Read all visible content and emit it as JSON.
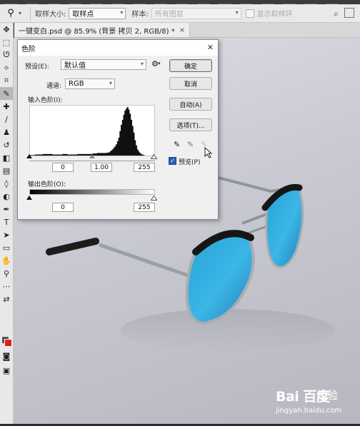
{
  "options_bar": {
    "tool_icon": "eyedropper-icon",
    "sample_size_label": "取样大小:",
    "sample_size_value": "取样点",
    "sample_label": "样本:",
    "sample_value": "所有图层",
    "show_ring_label": "显示取样环"
  },
  "document_tab": {
    "title": "一键变白.psd @ 85.9% (背景 拷贝 2, RGB/8) *",
    "close": "×"
  },
  "levels_dialog": {
    "title": "色阶",
    "close": "✕",
    "preset_label": "预设(E):",
    "preset_value": "默认值",
    "channel_label": "通道:",
    "channel_value": "RGB",
    "input_levels_label": "输入色阶(I):",
    "input_black": "0",
    "input_gamma": "1.00",
    "input_white": "255",
    "output_levels_label": "输出色阶(O):",
    "output_black": "0",
    "output_white": "255",
    "buttons": {
      "ok": "确定",
      "cancel": "取消",
      "auto": "自动(A)",
      "options": "选项(T)..."
    },
    "preview_label": "预览(P)",
    "preview_checked": true
  },
  "histogram": {
    "bins": [
      1,
      1,
      1,
      1,
      2,
      2,
      2,
      2,
      2,
      2,
      3,
      3,
      3,
      3,
      3,
      3,
      3,
      3,
      2,
      2,
      2,
      2,
      2,
      2,
      2,
      2,
      3,
      3,
      3,
      3,
      2,
      2,
      2,
      2,
      2,
      2,
      2,
      2,
      3,
      3,
      3,
      3,
      3,
      3,
      3,
      3,
      3,
      3,
      3,
      3,
      4,
      4,
      4,
      4,
      5,
      5,
      5,
      5,
      5,
      5,
      5,
      5,
      6,
      6,
      8,
      10,
      12,
      15,
      18,
      22,
      28,
      35,
      48,
      60,
      70,
      80,
      88,
      92,
      95,
      90,
      82,
      70,
      58,
      45,
      30,
      20,
      12,
      8,
      5,
      3,
      2,
      1,
      0,
      0,
      0,
      0,
      0,
      0,
      0,
      0
    ]
  },
  "watermark": {
    "logo": "Bai 百度",
    "jingyan": "经验",
    "url": "jingyan.baidu.com"
  }
}
